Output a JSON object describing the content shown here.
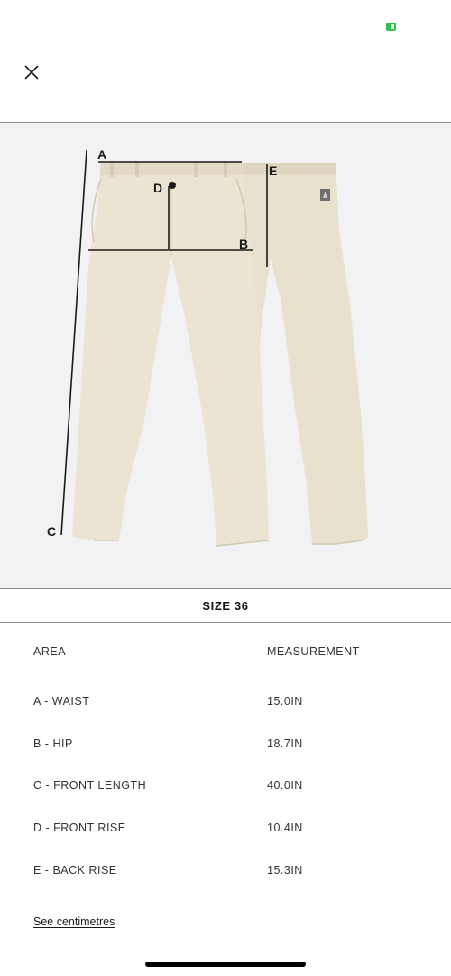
{
  "status": {
    "indicator_color": "#2fc24a"
  },
  "header": {
    "close_icon": "close-icon"
  },
  "figure": {
    "labels": {
      "a": "A",
      "b": "B",
      "c": "C",
      "d": "D",
      "e": "E"
    },
    "fabric_color": "#ebe4d3",
    "background_color": "#f2f2f4"
  },
  "size_bar": {
    "title": "SIZE 36"
  },
  "table": {
    "headers": {
      "area": "AREA",
      "measurement": "MEASUREMENT"
    },
    "rows": [
      {
        "area": "A - WAIST",
        "measurement": "15.0IN"
      },
      {
        "area": "B - HIP",
        "measurement": "18.7IN"
      },
      {
        "area": "C - FRONT LENGTH",
        "measurement": "40.0IN"
      },
      {
        "area": "D - FRONT RISE",
        "measurement": "10.4IN"
      },
      {
        "area": "E - BACK RISE",
        "measurement": "15.3IN"
      }
    ]
  },
  "footer": {
    "link_label": "See centimetres"
  }
}
